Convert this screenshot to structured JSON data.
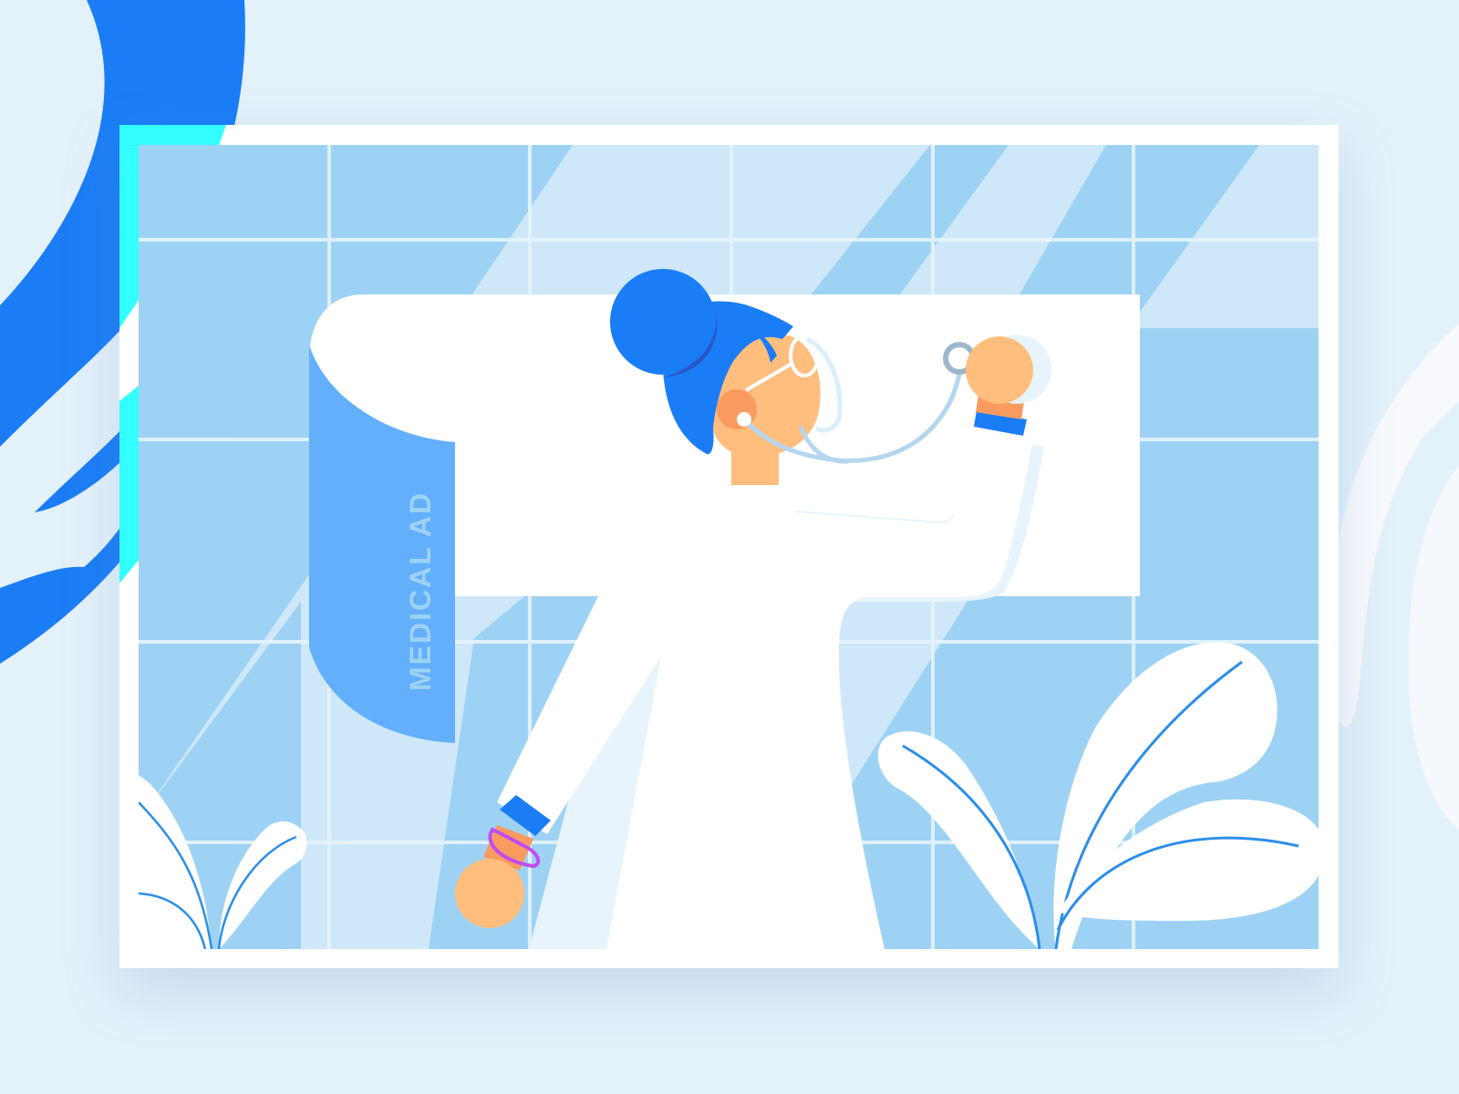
{
  "illustration": {
    "banner_text": "MEDICAL AD"
  },
  "colors": {
    "background": "#e3f1fa",
    "brand_blue": "#1b7df5",
    "cyan_accent": "#33ffff",
    "tile_blue": "#9ed2f4",
    "tile_light": "#cee8f9",
    "banner_blue": "#63affc",
    "skin": "#ffbd7e",
    "skin_shadow": "#f99b5f",
    "coat": "#ffffff",
    "bracelet": "#c24bf0",
    "leaf_vein": "#2d8ee8"
  },
  "icons": {
    "stethoscope": "stethoscope-icon",
    "leaf": "leaf-icon"
  }
}
